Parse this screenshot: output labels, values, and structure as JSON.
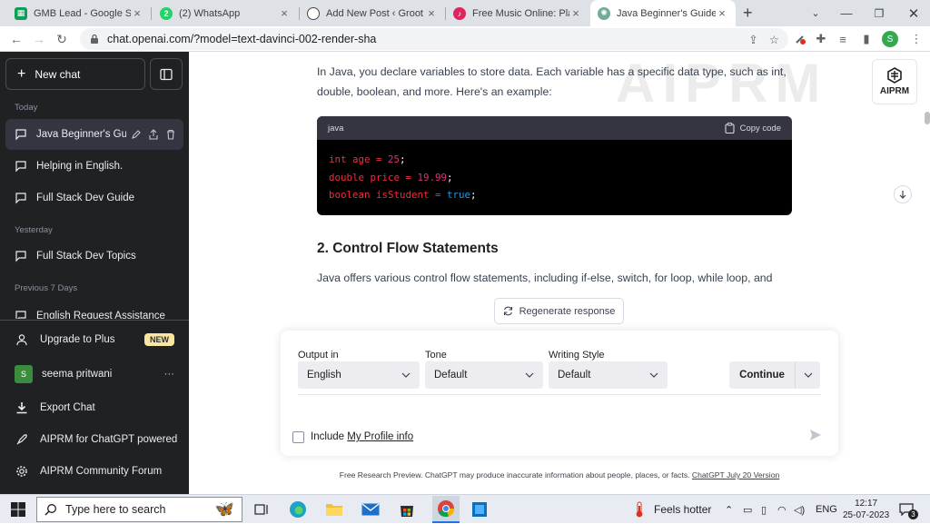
{
  "browser": {
    "tabs": [
      {
        "title": "GMB Lead - Google Sheets",
        "icon": "sheets-icon",
        "color": "#0f9d58"
      },
      {
        "title": "(2) WhatsApp",
        "icon": "whatsapp-icon",
        "color": "#25d366"
      },
      {
        "title": "Add New Post ‹ Groot Academy",
        "icon": "wordpress-icon",
        "color": "#464646"
      },
      {
        "title": "Free Music Online: Play & Download",
        "icon": "music-icon",
        "color": "#e0245e"
      },
      {
        "title": "Java Beginner's Guide",
        "icon": "chatgpt-icon",
        "color": "#74aa9c",
        "active": true
      }
    ],
    "new_tab": "+",
    "url": "chat.openai.com/?model=text-davinci-002-render-sha",
    "profile_initial": "S"
  },
  "sidebar": {
    "new_chat": "New chat",
    "sections": [
      {
        "label": "Today",
        "items": [
          "Java Beginner's Guide",
          "Helping in English.",
          "Full Stack Dev Guide"
        ]
      },
      {
        "label": "Yesterday",
        "items": [
          "Full Stack Dev Topics"
        ]
      },
      {
        "label": "Previous 7 Days",
        "items": [
          "English Request Assistance"
        ]
      }
    ],
    "upgrade": {
      "label": "Upgrade to Plus",
      "badge": "NEW"
    },
    "user": {
      "name": "seema pritwani",
      "initial": "S",
      "more": "···"
    },
    "export": "Export Chat",
    "aiprm_powered": "AIPRM for ChatGPT powered",
    "aiprm_forum": "AIPRM Community Forum"
  },
  "content": {
    "intro": "In Java, you declare variables to store data. Each variable has a specific data type, such as int, double, boolean, and more. Here's an example:",
    "code": {
      "lang": "java",
      "copy_label": "Copy code",
      "lines": [
        {
          "type": "int",
          "name": " age = ",
          "value": "25",
          "end": ";"
        },
        {
          "type": "double",
          "name": " price = ",
          "value": "19.99",
          "end": ";"
        },
        {
          "type": "boolean",
          "name": " isStudent = ",
          "value": "true",
          "end": ";"
        }
      ]
    },
    "heading": "2. Control Flow Statements",
    "para2": "Java offers various control flow statements, including if-else, switch, for loop, while loop, and",
    "watermark": "AIPRM",
    "aiprm_button": "AIPRM"
  },
  "composer": {
    "regenerate": "Regenerate response",
    "output_label": "Output in",
    "output_value": "English",
    "tone_label": "Tone",
    "tone_value": "Default",
    "style_label": "Writing Style",
    "style_value": "Default",
    "continue": "Continue",
    "include_prefix": "Include ",
    "include_link": "My Profile info",
    "footer_text": "Free Research Preview. ChatGPT may produce inaccurate information about people, places, or facts. ",
    "footer_link": "ChatGPT July 20 Version"
  },
  "taskbar": {
    "search_placeholder": "Type here to search",
    "weather": "Feels hotter",
    "language": "ENG",
    "time": "12:17",
    "date": "25-07-2023",
    "notifications": "3"
  }
}
